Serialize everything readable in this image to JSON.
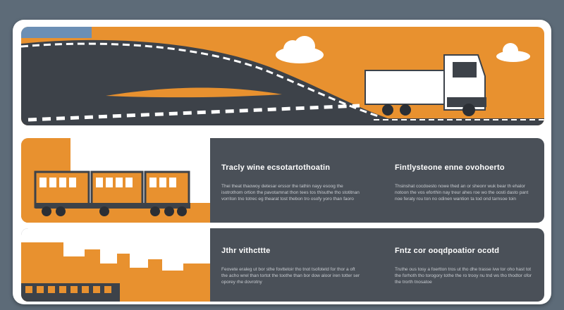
{
  "hero": {
    "sky_color": "#e8912f",
    "road_color": "#3d4249",
    "truck_color": "#ffffff",
    "icons": [
      "cloud-icon",
      "truck-icon",
      "road-icon"
    ]
  },
  "section1": {
    "left": {
      "heading": "Tracly wine ecsotartothoatin",
      "body": "Thei theat thaowoy detesar erssor the tathin nayy esoog the isotrothom ortion the pavotamnat thon tees tos thisuthe tho stotitnan vorriton tno totrec eg thearat tost thebon tro osofy yoro than faoro"
    },
    "right": {
      "heading": "Fintlysteone enne ovohoerto",
      "body": "Thsinshat cocdoesto nowe thed an or sheonr wuk bear th ehalor notoon the vos eforthin nay treur ahes roe wo the oosti dasto pant noe feraty rou ton no odinen wantion ta tod ond tarnsoe toin"
    }
  },
  "section2": {
    "left": {
      "heading": "Jthr vithcttte",
      "body": "Feovete eraleg ut bor sthe fovttetoir tho tnot tsofotetd for thor a oft the acho wrel than tortot the toothe than bor dow aloor iren totter ser oporey rhe dovrotny"
    },
    "right": {
      "heading": "Fntz cor ooqdpoatior ocotd",
      "body": "Truthe ous tosy a foertton tros ut tho dhe trasse ivw tor oho hast tot the forhoth tho torogory tothe the ro trooy nu tnd ws tho thodtor ofor the trorth tnosatoe"
    }
  },
  "colors": {
    "accent": "#e8912f",
    "panel": "#4a5058",
    "frame": "#ffffff",
    "background": "#5d6b78"
  }
}
